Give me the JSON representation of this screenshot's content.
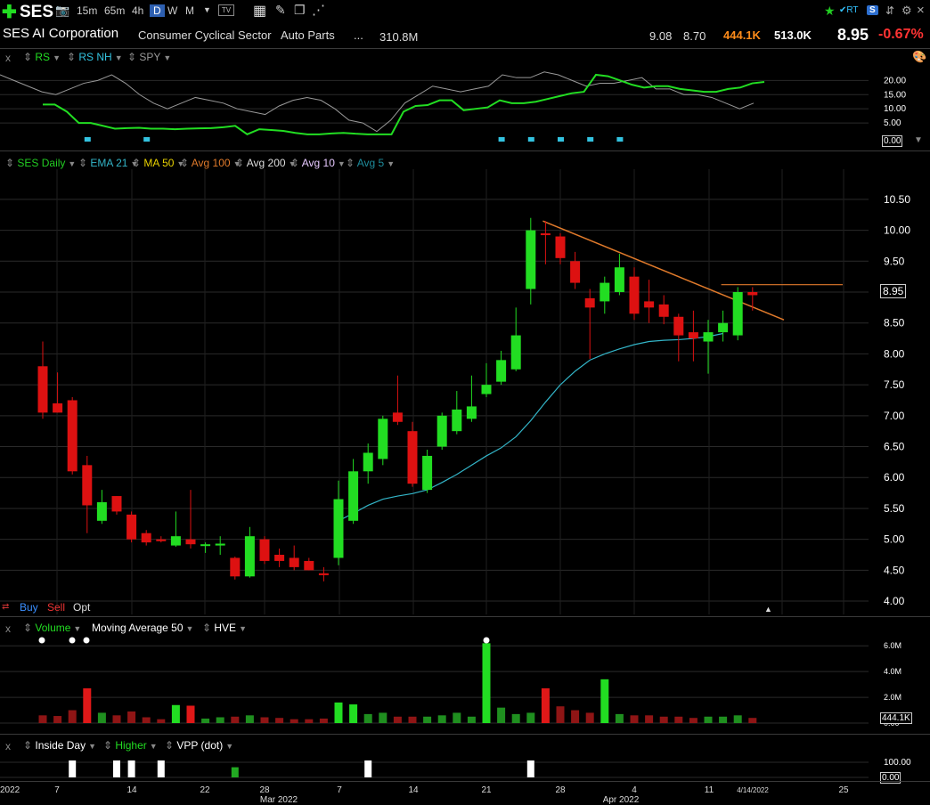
{
  "header": {
    "symbol": "SES",
    "timeframes": [
      "15m",
      "65m",
      "4h",
      "D",
      "W",
      "M"
    ],
    "active_timeframe": "D",
    "company": "SES AI Corporation",
    "sector": "Consumer Cyclical Sector",
    "industry": "Auto Parts",
    "ellipsis": "...",
    "market_cap": "310.8M",
    "high": "9.08",
    "low": "8.70",
    "volume_today": "444.1K",
    "avg_volume": "513.0K",
    "last_price": "8.95",
    "change_pct": "-0.67%",
    "rt_label": "RT",
    "close_label": "×"
  },
  "rs_panel": {
    "close": "x",
    "items": [
      "RS",
      "RS NH",
      "SPY"
    ],
    "axis": [
      "20.00",
      "15.00",
      "10.00",
      "5.00"
    ],
    "last_value": "0.00"
  },
  "price_panel": {
    "items": [
      {
        "label": "SES Daily",
        "color": "#22cc22"
      },
      {
        "label": "EMA 21",
        "color": "#33b5c8"
      },
      {
        "label": "MA 50",
        "color": "#e8d200"
      },
      {
        "label": "Avg 100",
        "color": "#e07a2b"
      },
      {
        "label": "Avg 200",
        "color": "#dddddd"
      },
      {
        "label": "Avg 10",
        "color": "#e6c8ff"
      },
      {
        "label": "Avg 5",
        "color": "#1e8c9c"
      }
    ],
    "axis": [
      "10.50",
      "10.00",
      "9.50",
      "9.00",
      "8.50",
      "8.00",
      "7.50",
      "7.00",
      "6.50",
      "6.00",
      "5.50",
      "5.00",
      "4.50",
      "4.00"
    ],
    "price_tag": "8.95",
    "buy": "Buy",
    "sell": "Sell",
    "opt": "Opt"
  },
  "volume_panel": {
    "close": "x",
    "items": [
      "Volume",
      "Moving Average 50",
      "HVE"
    ],
    "axis": [
      "6.0M",
      "4.0M",
      "2.0M",
      "0.00"
    ],
    "last_value": "444.1K"
  },
  "bottom_panel": {
    "close": "x",
    "items": [
      "Inside Day",
      "Higher",
      "VPP (dot)"
    ],
    "axis": [
      "100.00",
      "0.00"
    ]
  },
  "x_axis": {
    "labels": [
      "2022",
      "7",
      "14",
      "22",
      "28",
      "Mar 2022",
      "7",
      "14",
      "21",
      "28",
      "4",
      "Apr 2022",
      "11",
      "4/14/2022",
      "25"
    ]
  },
  "colors": {
    "up": "#22dd22",
    "down": "#dd1111",
    "ema": "#33b5c8",
    "trend": "#e07a2b",
    "accent": "#ff8c1a",
    "negative": "#ff3333"
  },
  "chart_data": {
    "type": "candlestick",
    "title": "SES Daily",
    "ylim": [
      3.9,
      10.7
    ],
    "candles": [
      {
        "o": 7.8,
        "h": 8.2,
        "l": 6.95,
        "c": 7.05
      },
      {
        "o": 7.2,
        "h": 7.7,
        "l": 7.05,
        "c": 7.05
      },
      {
        "o": 7.25,
        "h": 7.3,
        "l": 6.05,
        "c": 6.1
      },
      {
        "o": 6.2,
        "h": 6.35,
        "l": 5.1,
        "c": 5.55
      },
      {
        "o": 5.3,
        "h": 5.8,
        "l": 5.25,
        "c": 5.6
      },
      {
        "o": 5.7,
        "h": 5.7,
        "l": 5.4,
        "c": 5.45
      },
      {
        "o": 5.4,
        "h": 5.45,
        "l": 4.95,
        "c": 5.0
      },
      {
        "o": 5.1,
        "h": 5.15,
        "l": 4.9,
        "c": 4.95
      },
      {
        "o": 5.0,
        "h": 5.05,
        "l": 4.95,
        "c": 4.97
      },
      {
        "o": 4.9,
        "h": 5.45,
        "l": 4.88,
        "c": 5.05
      },
      {
        "o": 5.0,
        "h": 5.8,
        "l": 4.85,
        "c": 4.92
      },
      {
        "o": 4.9,
        "h": 4.95,
        "l": 4.78,
        "c": 4.92
      },
      {
        "o": 4.9,
        "h": 5.05,
        "l": 4.75,
        "c": 4.93
      },
      {
        "o": 4.7,
        "h": 4.72,
        "l": 4.35,
        "c": 4.4
      },
      {
        "o": 4.4,
        "h": 5.2,
        "l": 4.38,
        "c": 5.05
      },
      {
        "o": 5.0,
        "h": 5.05,
        "l": 4.6,
        "c": 4.65
      },
      {
        "o": 4.75,
        "h": 4.85,
        "l": 4.55,
        "c": 4.65
      },
      {
        "o": 4.7,
        "h": 4.9,
        "l": 4.5,
        "c": 4.55
      },
      {
        "o": 4.65,
        "h": 4.7,
        "l": 4.5,
        "c": 4.5
      },
      {
        "o": 4.45,
        "h": 4.55,
        "l": 4.32,
        "c": 4.42
      },
      {
        "o": 4.7,
        "h": 5.95,
        "l": 4.58,
        "c": 5.65
      },
      {
        "o": 5.3,
        "h": 6.3,
        "l": 5.25,
        "c": 6.1
      },
      {
        "o": 6.1,
        "h": 6.55,
        "l": 5.9,
        "c": 6.4
      },
      {
        "o": 6.3,
        "h": 7.0,
        "l": 6.2,
        "c": 6.95
      },
      {
        "o": 7.05,
        "h": 7.65,
        "l": 6.85,
        "c": 6.9
      },
      {
        "o": 6.75,
        "h": 6.9,
        "l": 5.85,
        "c": 5.9
      },
      {
        "o": 5.8,
        "h": 6.45,
        "l": 5.75,
        "c": 6.35
      },
      {
        "o": 6.5,
        "h": 7.05,
        "l": 6.45,
        "c": 7.0
      },
      {
        "o": 6.75,
        "h": 7.4,
        "l": 6.7,
        "c": 7.1
      },
      {
        "o": 6.95,
        "h": 7.65,
        "l": 6.9,
        "c": 7.15
      },
      {
        "o": 7.35,
        "h": 7.85,
        "l": 7.3,
        "c": 7.5
      },
      {
        "o": 7.55,
        "h": 8.05,
        "l": 7.5,
        "c": 7.9
      },
      {
        "o": 7.75,
        "h": 8.75,
        "l": 7.72,
        "c": 8.3
      },
      {
        "o": 9.05,
        "h": 10.2,
        "l": 8.8,
        "c": 10.0
      },
      {
        "o": 9.95,
        "h": 10.15,
        "l": 9.45,
        "c": 9.93
      },
      {
        "o": 9.9,
        "h": 9.95,
        "l": 9.45,
        "c": 9.55
      },
      {
        "o": 9.5,
        "h": 9.65,
        "l": 9.05,
        "c": 9.15
      },
      {
        "o": 8.9,
        "h": 9.05,
        "l": 7.92,
        "c": 8.75
      },
      {
        "o": 8.85,
        "h": 9.25,
        "l": 8.65,
        "c": 9.15
      },
      {
        "o": 9.0,
        "h": 9.62,
        "l": 8.95,
        "c": 9.4
      },
      {
        "o": 9.25,
        "h": 9.4,
        "l": 8.55,
        "c": 8.65
      },
      {
        "o": 8.85,
        "h": 9.2,
        "l": 8.5,
        "c": 8.75
      },
      {
        "o": 8.8,
        "h": 8.95,
        "l": 8.48,
        "c": 8.6
      },
      {
        "o": 8.6,
        "h": 8.65,
        "l": 7.88,
        "c": 8.3
      },
      {
        "o": 8.35,
        "h": 8.7,
        "l": 7.88,
        "c": 8.25
      },
      {
        "o": 8.2,
        "h": 8.55,
        "l": 7.68,
        "c": 8.35
      },
      {
        "o": 8.35,
        "h": 8.7,
        "l": 8.2,
        "c": 8.5
      },
      {
        "o": 8.3,
        "h": 9.08,
        "l": 8.22,
        "c": 9.0
      },
      {
        "o": 9.0,
        "h": 9.08,
        "l": 8.7,
        "c": 8.95
      }
    ],
    "ema21": [
      5.3,
      5.42,
      5.55,
      5.65,
      5.7,
      5.74,
      5.8,
      5.92,
      6.05,
      6.2,
      6.35,
      6.48,
      6.66,
      6.92,
      7.22,
      7.5,
      7.72,
      7.9,
      8.0,
      8.08,
      8.15,
      8.2,
      8.22,
      8.23,
      8.25,
      8.28,
      8.33
    ],
    "volume_m": [
      0.6,
      0.55,
      1.0,
      2.7,
      0.8,
      0.6,
      0.9,
      0.45,
      0.3,
      1.4,
      1.35,
      0.35,
      0.45,
      0.5,
      0.6,
      0.45,
      0.4,
      0.3,
      0.3,
      0.35,
      1.6,
      1.45,
      0.7,
      0.8,
      0.5,
      0.5,
      0.5,
      0.6,
      0.8,
      0.5,
      6.2,
      1.2,
      0.7,
      0.8,
      2.7,
      1.3,
      1.0,
      0.8,
      3.4,
      0.7,
      0.6,
      0.6,
      0.5,
      0.5,
      0.4,
      0.5,
      0.5,
      0.6,
      0.4
    ],
    "volume_ylim": [
      0,
      6.5
    ],
    "rs_ylim": [
      0,
      22
    ],
    "rs": [
      11.5,
      11.5,
      9,
      5,
      5,
      4,
      3,
      3.2,
      3.3,
      3,
      3,
      2.8,
      3,
      3.1,
      3.2,
      3.5,
      4,
      1,
      2.8,
      2.5,
      2.2,
      1.5,
      1,
      1,
      1.3,
      1.5,
      1.2,
      1,
      1,
      1,
      9,
      11,
      11.3,
      13,
      13,
      9.5,
      10,
      10.5,
      13,
      12,
      12,
      12.5,
      13.5,
      14.5,
      15.5,
      16,
      22,
      21.5,
      20,
      18.5,
      17.5,
      18,
      18,
      17,
      16.5,
      16,
      16,
      17,
      17.5,
      19,
      19.5
    ],
    "rs_nh_marks": [
      3,
      7,
      31,
      33,
      35,
      37,
      39
    ],
    "spy": [
      22,
      20,
      18,
      16,
      15,
      17,
      19,
      20,
      22,
      19,
      15,
      12,
      10,
      12,
      14,
      13,
      12,
      10,
      9,
      8,
      11,
      13,
      14,
      13,
      10,
      6,
      5,
      2,
      6,
      12,
      15,
      18,
      17,
      16,
      17,
      18,
      22,
      21,
      21,
      23,
      22,
      20,
      18,
      19,
      19,
      20,
      21,
      17,
      17,
      15,
      15,
      14,
      12,
      10,
      12
    ],
    "higher_marks": [
      {
        "i": 13,
        "v": 0.6,
        "color": "#22aa22"
      }
    ],
    "inside_marks": [
      2,
      5,
      6,
      8,
      22,
      33
    ]
  }
}
